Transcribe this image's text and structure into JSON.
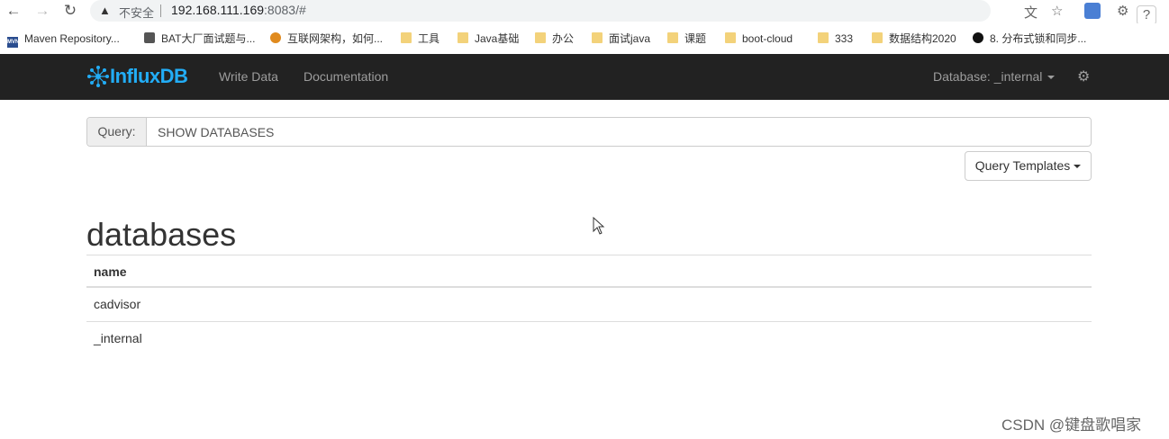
{
  "browser": {
    "insecure_label": "不安全",
    "url_host": "192.168.111.169",
    "url_rest": ":8083/#"
  },
  "bookmarks": [
    {
      "label": "Maven Repository...",
      "icon": "maven-icon"
    },
    {
      "label": "BAT大厂面试题与...",
      "icon": "bookmark-icon"
    },
    {
      "label": "互联网架构，如何...",
      "icon": "bookmark-icon"
    },
    {
      "label": "工具",
      "icon": "folder-icon"
    },
    {
      "label": "Java基础",
      "icon": "folder-icon"
    },
    {
      "label": "办公",
      "icon": "folder-icon"
    },
    {
      "label": "面试java",
      "icon": "folder-icon"
    },
    {
      "label": "课题",
      "icon": "folder-icon"
    },
    {
      "label": "boot-cloud",
      "icon": "folder-icon"
    },
    {
      "label": "333",
      "icon": "folder-icon"
    },
    {
      "label": "数据结构2020",
      "icon": "folder-icon"
    },
    {
      "label": "8. 分布式锁和同步...",
      "icon": "github-icon"
    }
  ],
  "navbar": {
    "brand": "InfluxDB",
    "links": [
      "Write Data",
      "Documentation"
    ],
    "database_label": "Database: _internal"
  },
  "query": {
    "addon_label": "Query:",
    "value": "SHOW DATABASES",
    "templates_label": "Query Templates"
  },
  "results": {
    "title": "databases",
    "column": "name",
    "rows": [
      "cadvisor",
      "_internal"
    ]
  },
  "watermark": "CSDN @键盘歌唱家",
  "colors": {
    "navbar_bg": "#222222",
    "brand": "#22adf6",
    "nav_text": "#9d9d9d"
  }
}
